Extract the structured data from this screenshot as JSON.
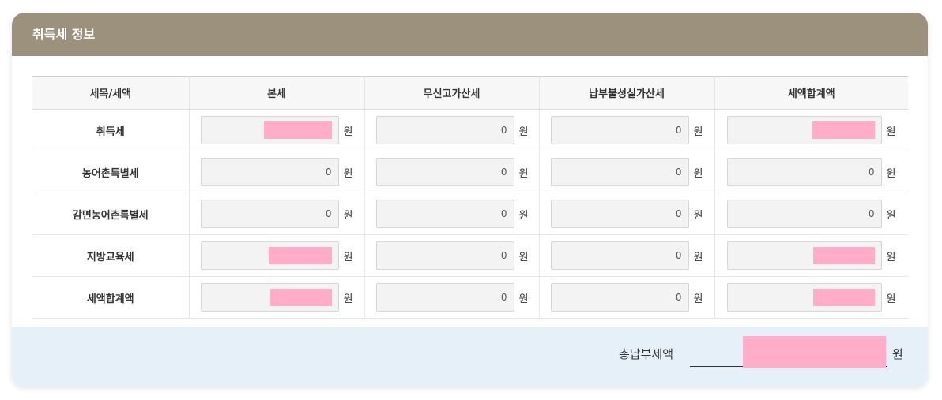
{
  "panel": {
    "title": "취득세 정보"
  },
  "table": {
    "headers": [
      "세목/세액",
      "본세",
      "무신고가산세",
      "납부불성실가산세",
      "세액합계액"
    ],
    "unit": "원",
    "rows": [
      {
        "label": "취득세",
        "values": [
          "",
          "0",
          "0",
          ""
        ]
      },
      {
        "label": "농어촌특별세",
        "values": [
          "0",
          "0",
          "0",
          "0"
        ]
      },
      {
        "label": "감면농어촌특별세",
        "values": [
          "0",
          "0",
          "0",
          "0"
        ]
      },
      {
        "label": "지방교육세",
        "values": [
          "",
          "0",
          "0",
          ""
        ]
      },
      {
        "label": "세액합계액",
        "values": [
          "",
          "0",
          "0",
          ""
        ]
      }
    ]
  },
  "total": {
    "label": "총납부세액",
    "value": "",
    "unit": "원"
  },
  "colors": {
    "header_bg": "#9b917d",
    "footer_bg": "#e5f0f8",
    "redaction": "#ffadc9"
  }
}
